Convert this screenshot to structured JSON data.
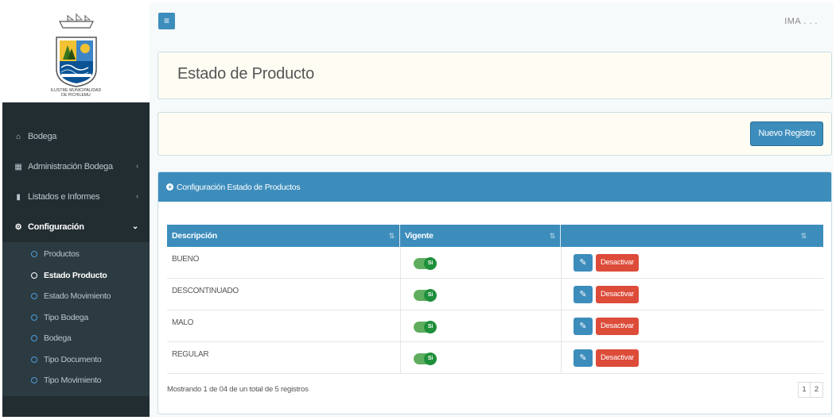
{
  "sidebar": {
    "logo": {
      "banner_text": "PICHILEMU",
      "caption_line1": "ILUSTRE MUNICIPALIDAD",
      "caption_line2": "DE PICHILEMU"
    },
    "items": [
      {
        "label": "Bodega",
        "icon": "home-icon"
      },
      {
        "label": "Administración Bodega",
        "icon": "table-icon"
      },
      {
        "label": "Listados e Informes",
        "icon": "file-icon"
      },
      {
        "label": "Configuración",
        "icon": "gears-icon"
      }
    ],
    "submenu": [
      {
        "label": "Productos"
      },
      {
        "label": "Estado Producto"
      },
      {
        "label": "Estado Movimiento"
      },
      {
        "label": "Tipo Bodega"
      },
      {
        "label": "Bodega"
      },
      {
        "label": "Tipo Documento"
      },
      {
        "label": "Tipo Movimiento"
      }
    ]
  },
  "topbar": {
    "user": "IMA . . ."
  },
  "header": {
    "title": "Estado de Producto"
  },
  "actions": {
    "new_label": "Nuevo Registro"
  },
  "panel": {
    "title": "Configuración Estado de Productos"
  },
  "table": {
    "columns": [
      "Descripción",
      "Vigente",
      ""
    ],
    "rows": [
      {
        "descripcion": "BUENO",
        "vigente": "Si",
        "action": "Desactivar"
      },
      {
        "descripcion": "DESCONTINUADO",
        "vigente": "Si",
        "action": "Desactivar"
      },
      {
        "descripcion": "MALO",
        "vigente": "Si",
        "action": "Desactivar"
      },
      {
        "descripcion": "REGULAR",
        "vigente": "Si",
        "action": "Desactivar"
      }
    ],
    "info": "Mostrando 1 de 04 de un total de 5 registros",
    "pages": [
      "1",
      "2"
    ]
  },
  "colors": {
    "sidebar_bg": "#222d32",
    "primary": "#3c8dbc",
    "danger": "#dd4b39",
    "toggle_on": "#1e8f3a"
  }
}
